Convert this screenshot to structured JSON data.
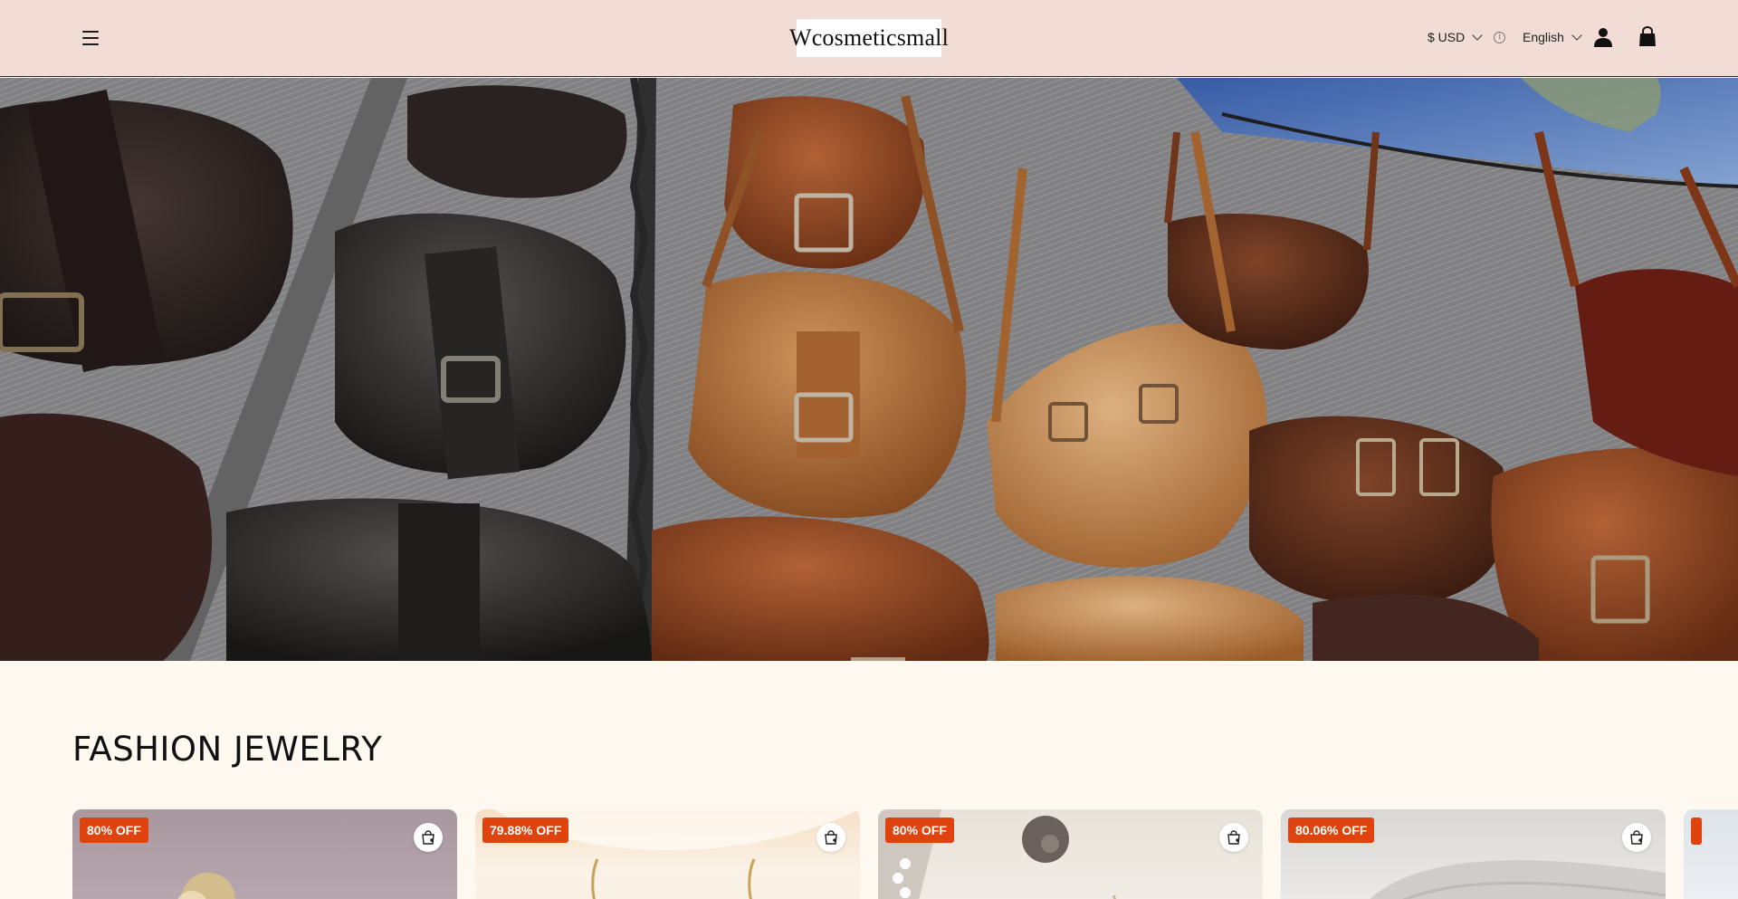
{
  "header": {
    "logo_text": "Wcosmeticsmall",
    "currency_label": "$ USD",
    "currency_info": "i",
    "language_label": "English",
    "icons": [
      "menu-icon",
      "chevron-down-icon",
      "info-icon",
      "user-icon",
      "shopping-bag-icon"
    ]
  },
  "hero": {
    "image": "leather-bags-hero"
  },
  "section": {
    "title": "FASHION JEWELRY"
  },
  "products": [
    {
      "badge": "80% OFF"
    },
    {
      "badge": "79.88% OFF"
    },
    {
      "badge": "80% OFF"
    },
    {
      "badge": "80.06% OFF"
    }
  ],
  "colors": {
    "header_bg": "#f2ddd6",
    "page_bg": "#fdf9f1",
    "badge_bg": "#e0440e"
  }
}
